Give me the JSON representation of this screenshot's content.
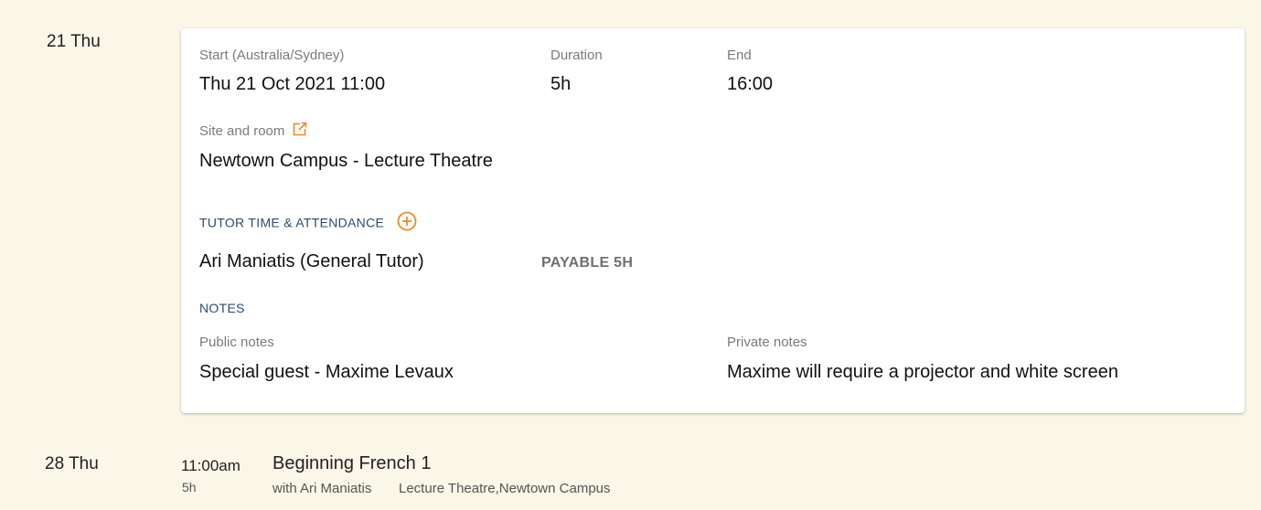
{
  "days": [
    {
      "label": "21 Thu"
    },
    {
      "label": "28 Thu"
    }
  ],
  "session": {
    "start_label": "Start (Australia/Sydney)",
    "start_value": "Thu 21 Oct 2021 11:00",
    "duration_label": "Duration",
    "duration_value": "5h",
    "end_label": "End",
    "end_value": "16:00",
    "site_label": "Site and room",
    "site_icon": "external-link-icon",
    "site_value": "Newtown Campus - Lecture Theatre",
    "tutor_heading": "TUTOR TIME & ATTENDANCE",
    "tutor_add_icon": "add-circle-icon",
    "tutor_name": "Ari Maniatis (General Tutor)",
    "tutor_payable": "PAYABLE 5H",
    "notes_heading": "NOTES",
    "public_notes_label": "Public notes",
    "public_notes_value": "Special guest - Maxime Levaux",
    "private_notes_label": "Private notes",
    "private_notes_value": "Maxime will require a projector and white screen"
  },
  "next_event": {
    "time": "11:00am",
    "duration": "5h",
    "title": "Beginning French 1",
    "tutor": "with Ari Maniatis",
    "location": "Lecture Theatre,Newtown Campus"
  },
  "colors": {
    "background": "#faf6e8",
    "card": "#ffffff",
    "accent_orange": "#f08a24",
    "heading_blue": "#2c4a73",
    "label_gray": "#7a7a7a"
  }
}
